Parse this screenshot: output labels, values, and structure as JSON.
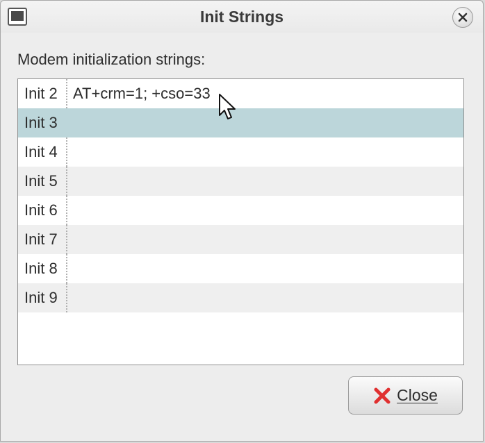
{
  "window": {
    "title": "Init Strings"
  },
  "dialog": {
    "prompt": "Modem initialization strings:"
  },
  "list": {
    "rows": [
      {
        "label": "Init 2",
        "value": "AT+crm=1; +cso=33"
      },
      {
        "label": "Init 3",
        "value": "",
        "selected": true
      },
      {
        "label": "Init 4",
        "value": ""
      },
      {
        "label": "Init 5",
        "value": ""
      },
      {
        "label": "Init 6",
        "value": ""
      },
      {
        "label": "Init 7",
        "value": ""
      },
      {
        "label": "Init 8",
        "value": ""
      },
      {
        "label": "Init 9",
        "value": ""
      }
    ]
  },
  "buttons": {
    "close_label": "Close",
    "close_icon": "red-x-icon"
  },
  "colors": {
    "selected_row": "#bcd6da",
    "alt_row": "#efefef",
    "close_icon": "#e03030"
  }
}
